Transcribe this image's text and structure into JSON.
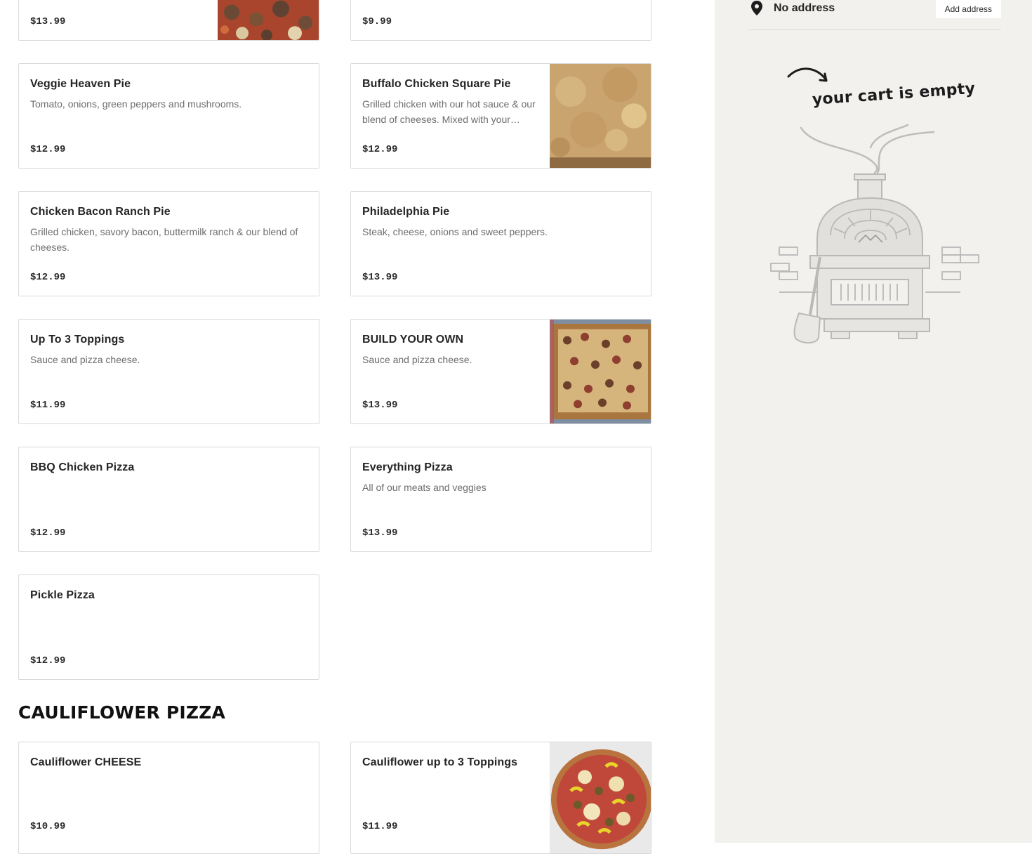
{
  "menu": {
    "cards_row0": [
      {
        "price": "$13.99"
      },
      {
        "price": "$9.99"
      }
    ],
    "cards": [
      {
        "name": "Veggie Heaven Pie",
        "desc": "Tomato, onions, green peppers and mushrooms.",
        "price": "$12.99"
      },
      {
        "name": "Buffalo Chicken Square Pie",
        "desc": "Grilled chicken with our hot sauce & our blend of cheeses. Mixed with your…",
        "price": "$12.99"
      },
      {
        "name": "Chicken Bacon Ranch Pie",
        "desc": "Grilled chicken, savory bacon, buttermilk ranch & our blend of cheeses.",
        "price": "$12.99"
      },
      {
        "name": "Philadelphia Pie",
        "desc": "Steak, cheese, onions and sweet peppers.",
        "price": "$13.99"
      },
      {
        "name": "Up To 3 Toppings",
        "desc": "Sauce and pizza cheese.",
        "price": "$11.99"
      },
      {
        "name": "BUILD YOUR OWN",
        "desc": "Sauce and pizza cheese.",
        "price": "$13.99"
      },
      {
        "name": "BBQ Chicken Pizza",
        "desc": "",
        "price": "$12.99"
      },
      {
        "name": "Everything Pizza",
        "desc": "All of our meats and veggies",
        "price": "$13.99"
      },
      {
        "name": "Pickle Pizza",
        "desc": "",
        "price": "$12.99"
      }
    ],
    "section_title": "CAULIFLOWER PIZZA",
    "cauliflower": [
      {
        "name": "Cauliflower CHEESE",
        "price": "$10.99"
      },
      {
        "name": "Cauliflower up to 3 Toppings",
        "price": "$11.99"
      }
    ]
  },
  "sidebar": {
    "address_text": "No address",
    "add_address_label": "Add address",
    "cart_empty_text": "your cart is empty"
  },
  "icons": [
    "location-pin-icon",
    "arrow-icon"
  ]
}
